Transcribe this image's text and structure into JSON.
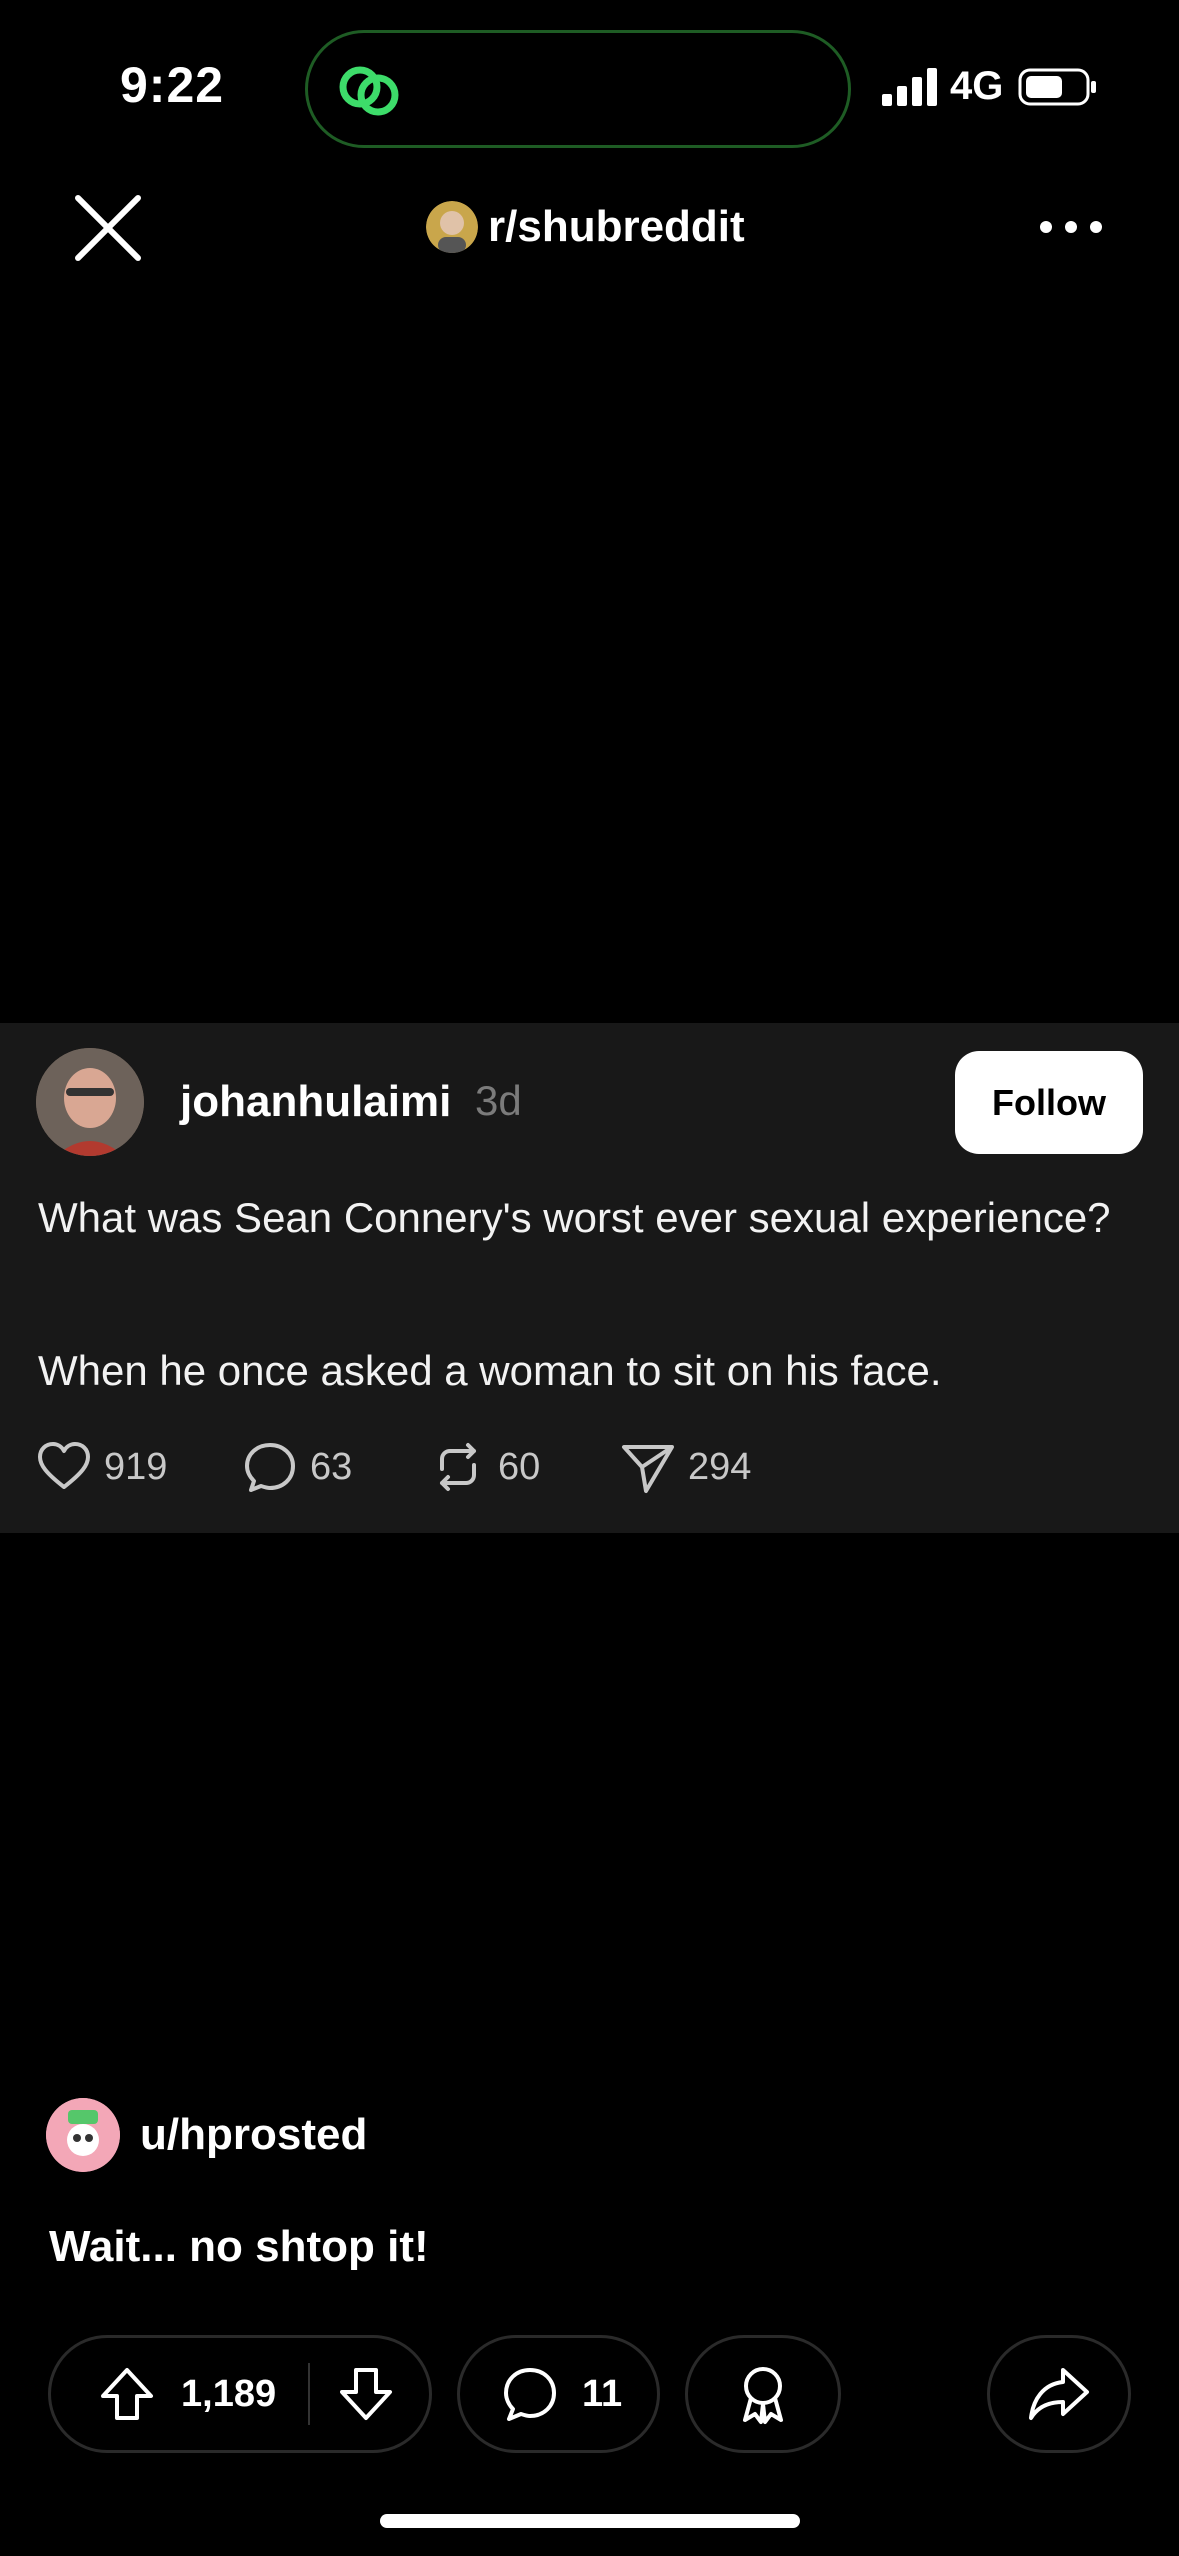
{
  "status_bar": {
    "time": "9:22",
    "network": "4G",
    "island_icon": "link-rings-icon",
    "island_color": "#3ddc6a"
  },
  "header": {
    "subreddit": "r/shubreddit",
    "close_icon": "close-icon",
    "more_icon": "more-horizontal-icon"
  },
  "embedded_post": {
    "author": "johanhulaimi",
    "age": "3d",
    "follow_label": "Follow",
    "title": "What was Sean Connery's worst ever sexual experience?",
    "body": "When he once asked a woman to sit on his face.",
    "stats": {
      "likes": "919",
      "comments": "63",
      "reposts": "60",
      "shares": "294"
    }
  },
  "reddit_post": {
    "poster": "u/hprosted",
    "caption": "Wait... no shtop it!"
  },
  "action_bar": {
    "votes": "1,189",
    "comments": "11"
  }
}
